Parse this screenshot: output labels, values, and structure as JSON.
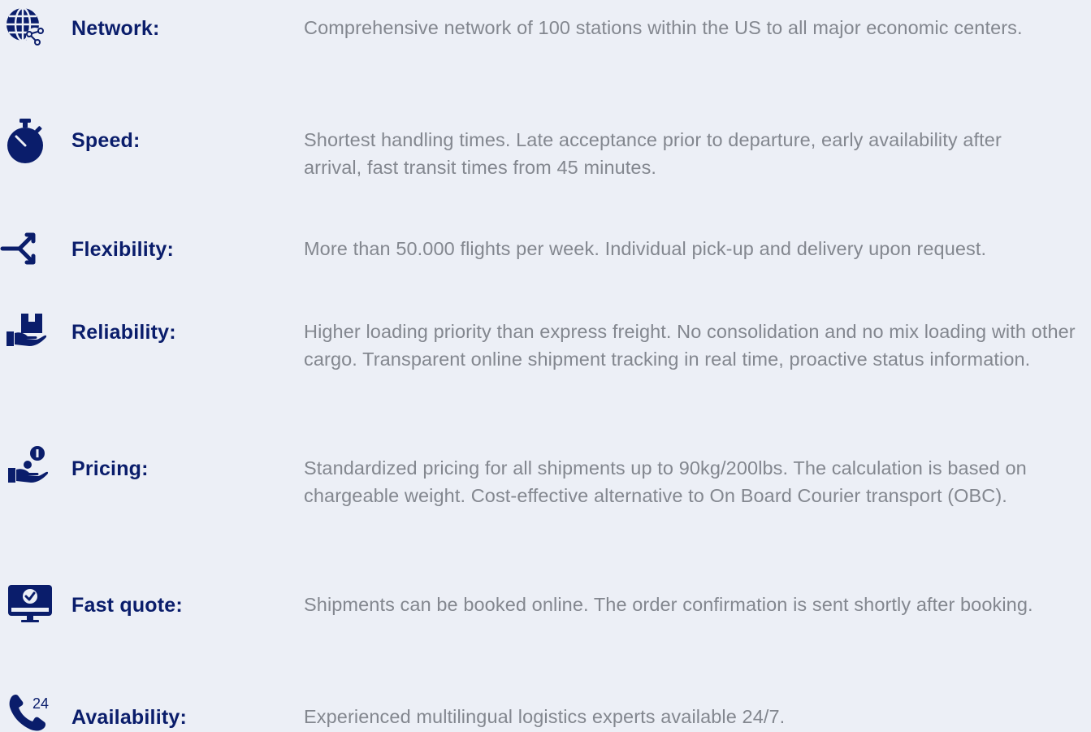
{
  "colors": {
    "background": "#eceff6",
    "label": "#0a1d6b",
    "description": "#83878f",
    "icon": "#0a1d6b"
  },
  "features": [
    {
      "icon": "globe-network-icon",
      "label": "Network:",
      "description": "Comprehensive network of 100 stations within the US to all major economic centers."
    },
    {
      "icon": "stopwatch-icon",
      "label": "Speed:",
      "description": "Shortest handling times. Late acceptance prior to departure, early availability after arrival, fast transit times from 45 minutes."
    },
    {
      "icon": "split-arrow-icon",
      "label": "Flexibility:",
      "description": "More than 50.000 flights per week. Individual pick-up and delivery upon request."
    },
    {
      "icon": "hand-box-icon",
      "label": "Reliability:",
      "description": "Higher loading priority than express freight. No consolidation and no mix loading with other cargo. Transparent online shipment tracking in real time, proactive status information."
    },
    {
      "icon": "hand-coin-icon",
      "label": "Pricing:",
      "description": "Standardized pricing for all shipments up to 90kg/200lbs. The calculation is based on chargeable weight. Cost-effective alternative to On Board Courier transport (OBC)."
    },
    {
      "icon": "monitor-check-icon",
      "label": "Fast quote:",
      "description": "Shipments can be booked online. The order confirmation is sent shortly after booking."
    },
    {
      "icon": "phone-24-icon",
      "label": "Availability:",
      "description": "Experienced multilingual logistics experts available 24/7."
    }
  ]
}
